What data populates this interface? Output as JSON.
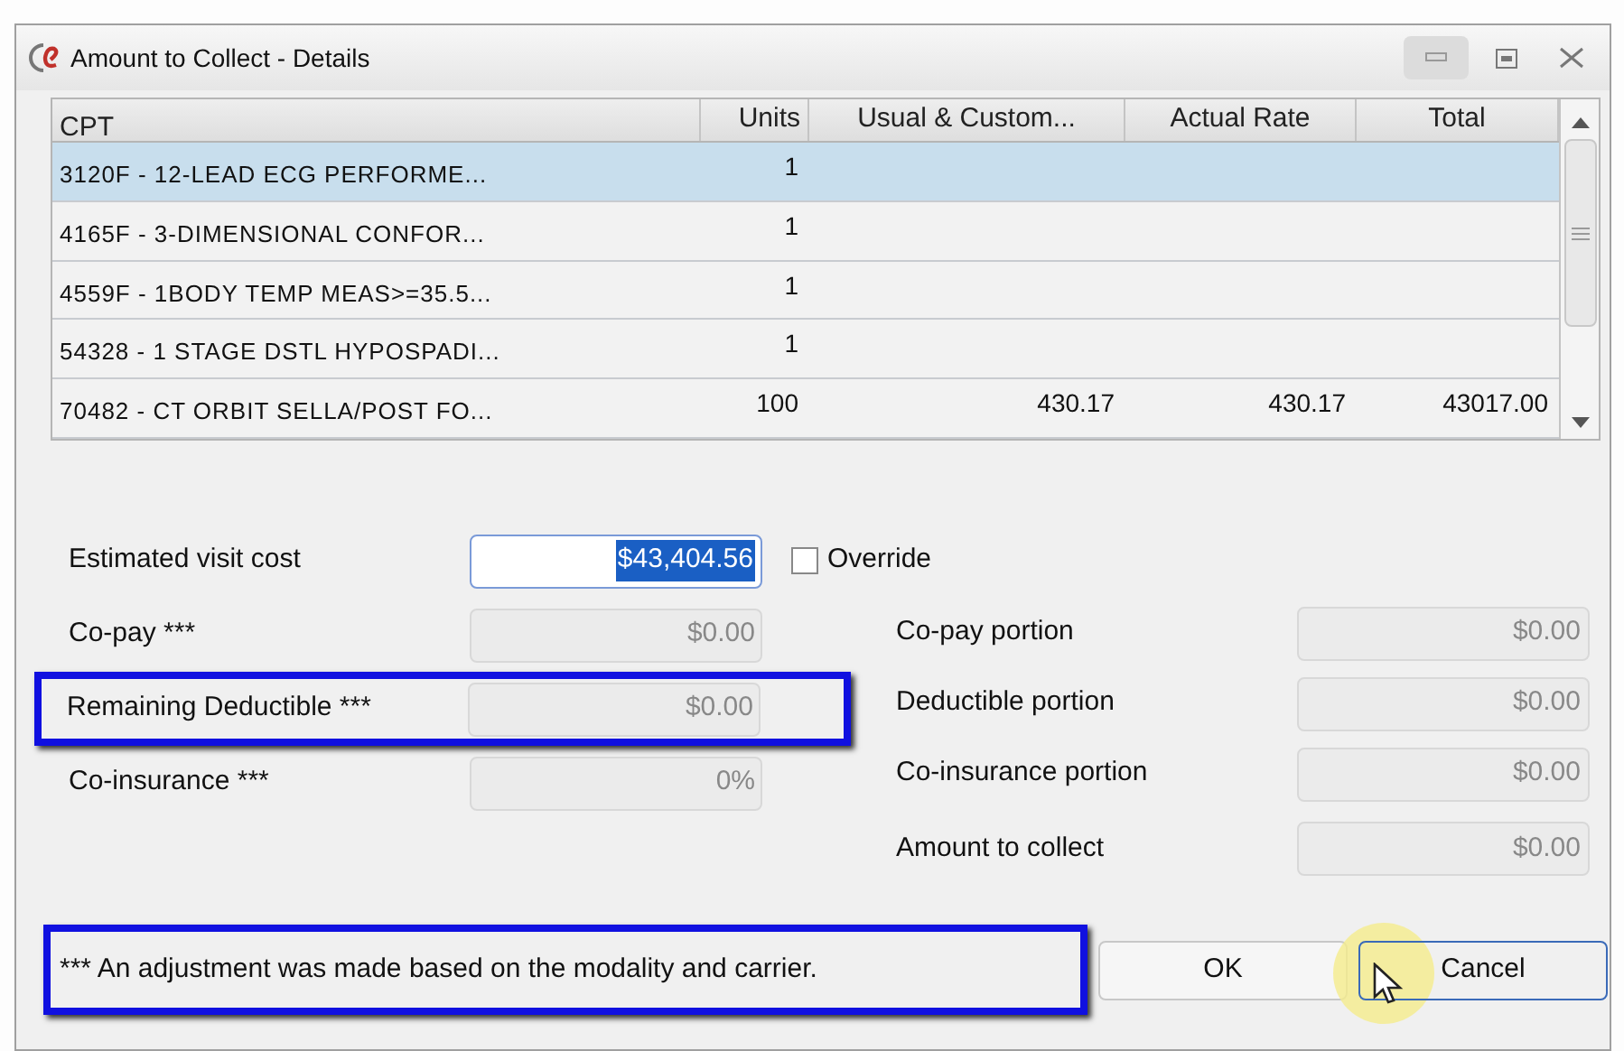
{
  "window": {
    "title": "Amount to Collect - Details"
  },
  "table": {
    "columns": [
      "CPT",
      "Units",
      "Usual & Custom...",
      "Actual Rate",
      "Total"
    ],
    "rows": [
      {
        "cells": [
          "3120F - 12-LEAD ECG PERFORME...",
          "1",
          "",
          "",
          ""
        ],
        "selected": true
      },
      {
        "cells": [
          "4165F - 3-DIMENSIONAL CONFOR...",
          "1",
          "",
          "",
          ""
        ],
        "selected": false
      },
      {
        "cells": [
          "4559F - 1BODY TEMP MEAS>=35.5...",
          "1",
          "",
          "",
          ""
        ],
        "selected": false
      },
      {
        "cells": [
          "54328 - 1 STAGE DSTL HYPOSPADI...",
          "1",
          "",
          "",
          ""
        ],
        "selected": false
      },
      {
        "cells": [
          "70482 - CT ORBIT SELLA/POST FO...",
          "100",
          "430.17",
          "430.17",
          "43017.00"
        ],
        "selected": false
      }
    ]
  },
  "left_fields": [
    {
      "label": "Estimated visit cost",
      "value": "$43,404.56",
      "disabled": false,
      "highlighted": false
    },
    {
      "label": "Co-pay ***",
      "value": "$0.00",
      "disabled": true,
      "highlighted": false
    },
    {
      "label": "Remaining Deductible ***",
      "value": "$0.00",
      "disabled": true,
      "highlighted": true
    },
    {
      "label": "Co-insurance ***",
      "value": "0%",
      "disabled": true,
      "highlighted": false
    }
  ],
  "override": {
    "label": "Override",
    "checked": false
  },
  "right_fields": [
    {
      "label": "Co-pay portion",
      "value": "$0.00"
    },
    {
      "label": "Deductible portion",
      "value": "$0.00"
    },
    {
      "label": "Co-insurance portion",
      "value": "$0.00"
    },
    {
      "label": "Amount to collect",
      "value": "$0.00"
    }
  ],
  "footnote": {
    "text": "*** An adjustment was made based on the modality and carrier.",
    "highlighted": true
  },
  "buttons": [
    "OK",
    "Cancel"
  ]
}
